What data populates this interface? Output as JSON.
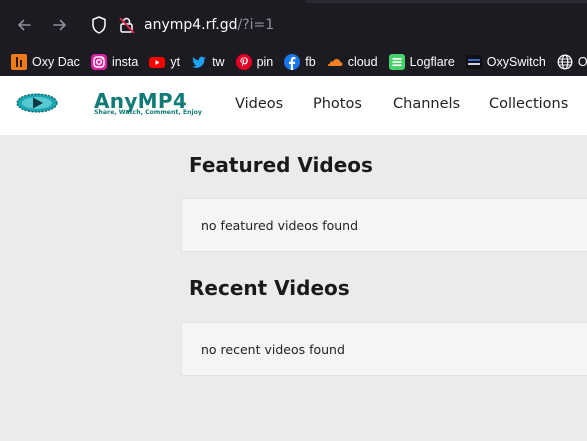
{
  "browser": {
    "url_host": "anymp4.rf.gd",
    "url_path": "/?i=1",
    "bookmarks": [
      {
        "label": "Oxy Dac",
        "icon": "oxydac-icon",
        "color": "#f07b1c"
      },
      {
        "label": "insta",
        "icon": "instagram-icon",
        "color": "#d6249f"
      },
      {
        "label": "yt",
        "icon": "youtube-icon",
        "color": "#ff0000"
      },
      {
        "label": "tw",
        "icon": "twitter-icon",
        "color": "#1da1f2"
      },
      {
        "label": "pin",
        "icon": "pinterest-icon",
        "color": "#e60023"
      },
      {
        "label": "fb",
        "icon": "facebook-icon",
        "color": "#1877f2"
      },
      {
        "label": "cloud",
        "icon": "cloudflare-icon",
        "color": "#f38020"
      },
      {
        "label": "Logflare",
        "icon": "logflare-icon",
        "color": "#45d16a"
      },
      {
        "label": "OxySwitch",
        "icon": "oxyswitch-icon",
        "color": "#111111"
      },
      {
        "label": "Oxy",
        "icon": "globe-icon",
        "color": "#fbfbfe"
      }
    ]
  },
  "site": {
    "logo_title": "AnyMP4",
    "logo_tagline": "Share, Watch, Comment, Enjoy",
    "nav": [
      "Videos",
      "Photos",
      "Channels",
      "Collections"
    ]
  },
  "featured": {
    "title": "Featured Videos",
    "empty_text": "no featured videos found"
  },
  "recent": {
    "title": "Recent Videos",
    "empty_text": "no recent videos found"
  }
}
